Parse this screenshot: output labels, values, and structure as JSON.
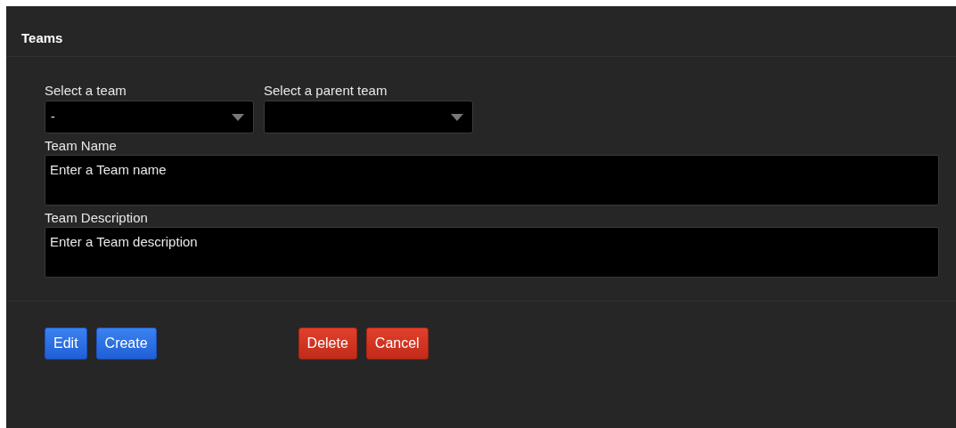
{
  "panel": {
    "title": "Teams"
  },
  "selects": [
    {
      "label": "Select a team",
      "value": "-"
    },
    {
      "label": "Select a parent team"
    }
  ],
  "fields": [
    {
      "label": "Team Name",
      "placeholder": "Enter a Team name"
    },
    {
      "label": "Team Description",
      "placeholder": "Enter a Team description"
    }
  ],
  "button_groups": [
    [
      {
        "label": "Edit",
        "kind": "primary"
      },
      {
        "label": "Create",
        "kind": "primary"
      }
    ],
    [
      {
        "label": "Delete",
        "kind": "danger"
      },
      {
        "label": "Cancel",
        "kind": "danger"
      }
    ]
  ]
}
